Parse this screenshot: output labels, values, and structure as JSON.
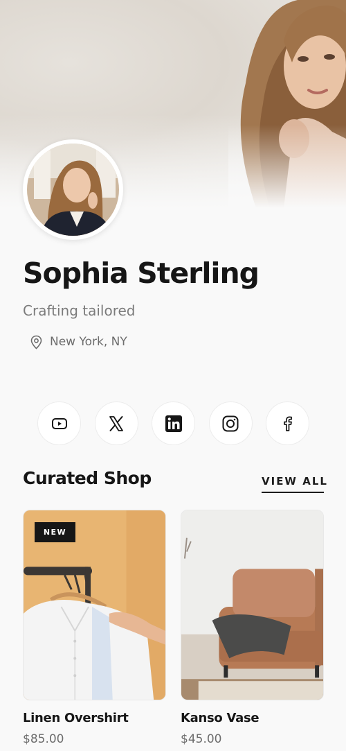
{
  "profile": {
    "name": "Sophia Sterling",
    "tagline": "Crafting tailored",
    "location": "New York, NY"
  },
  "social": [
    {
      "icon": "youtube-icon",
      "label": "YouTube"
    },
    {
      "icon": "x-icon",
      "label": "X"
    },
    {
      "icon": "linkedin-icon",
      "label": "LinkedIn"
    },
    {
      "icon": "instagram-icon",
      "label": "Instagram"
    },
    {
      "icon": "facebook-icon",
      "label": "Facebook"
    }
  ],
  "shop": {
    "title": "Curated Shop",
    "view_all": "VIEW ALL",
    "products": [
      {
        "name": "Linen Overshirt",
        "price": "$85.00",
        "badge": "NEW"
      },
      {
        "name": "Kanso Vase",
        "price": "$45.00"
      }
    ]
  },
  "colors": {
    "background": "#f9f9f9",
    "text": "#161616",
    "muted": "#7b7b7b",
    "badge": "#161616"
  }
}
